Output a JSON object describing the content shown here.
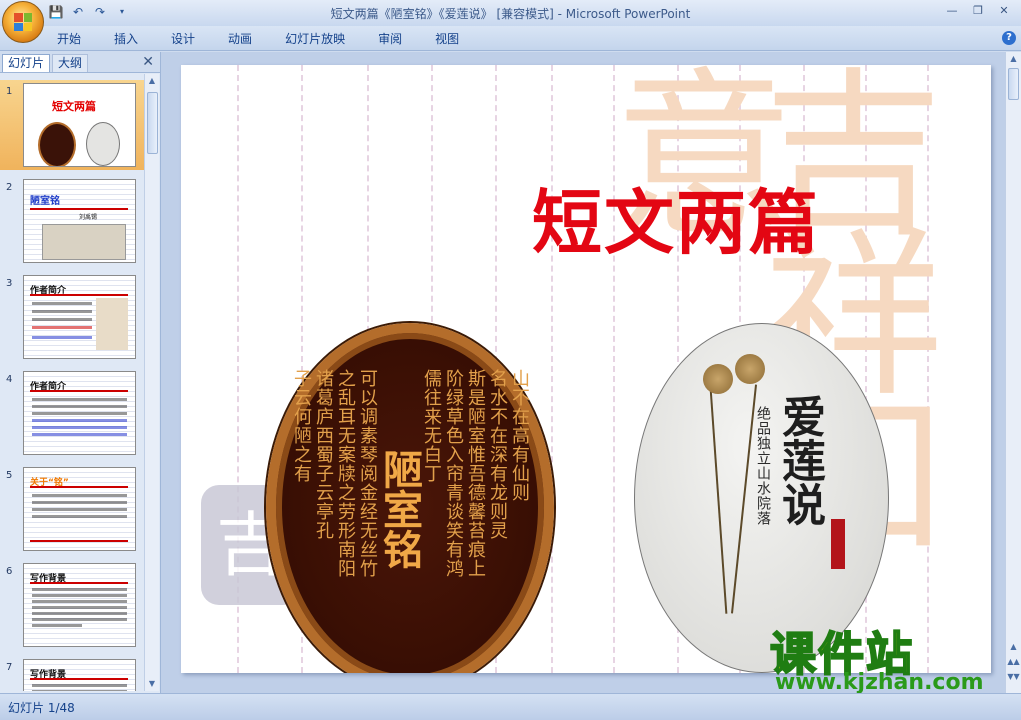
{
  "window": {
    "title": "短文两篇《陋室铭》《爱莲说》 [兼容模式] - Microsoft PowerPoint"
  },
  "quick_access": {
    "save_icon": "save-icon",
    "undo_icon": "undo-icon",
    "redo_icon": "redo-icon"
  },
  "ribbon": {
    "tabs": [
      "开始",
      "插入",
      "设计",
      "动画",
      "幻灯片放映",
      "审阅",
      "视图"
    ]
  },
  "pane": {
    "tab_slides": "幻灯片",
    "tab_outline": "大纲",
    "thumbnails": [
      {
        "num": "1",
        "title": "短文两篇"
      },
      {
        "num": "2",
        "title": "陋室铭",
        "subtitle": "刘禹锡"
      },
      {
        "num": "3",
        "title": "作者简介"
      },
      {
        "num": "4",
        "title": "作者简介"
      },
      {
        "num": "5",
        "title": "关于“铭”"
      },
      {
        "num": "6",
        "title": "写作背景"
      },
      {
        "num": "7",
        "title": "写作背景"
      }
    ]
  },
  "slide": {
    "title": "短文两篇",
    "plaque_title": "陋室铭",
    "plaque_columns": [
      "山不在高有仙则",
      "名水不在深有龙则灵",
      "斯是陋室惟吾德馨苔痕上",
      "阶绿草色入帘青谈笑有鸿",
      "儒往来无白丁",
      "可以调素琴阅金经无丝竹",
      "之乱耳无案牍之劳形南阳",
      "诸葛庐西蜀子云亭孔",
      "子云何陋之有"
    ],
    "lotus_title": "爱莲说",
    "lotus_small": "绝品独立山水院落"
  },
  "watermark": {
    "site_name": "课件站",
    "site_url": "www.kjzhan.com"
  },
  "status": {
    "slide_counter": "幻灯片 1/48"
  }
}
